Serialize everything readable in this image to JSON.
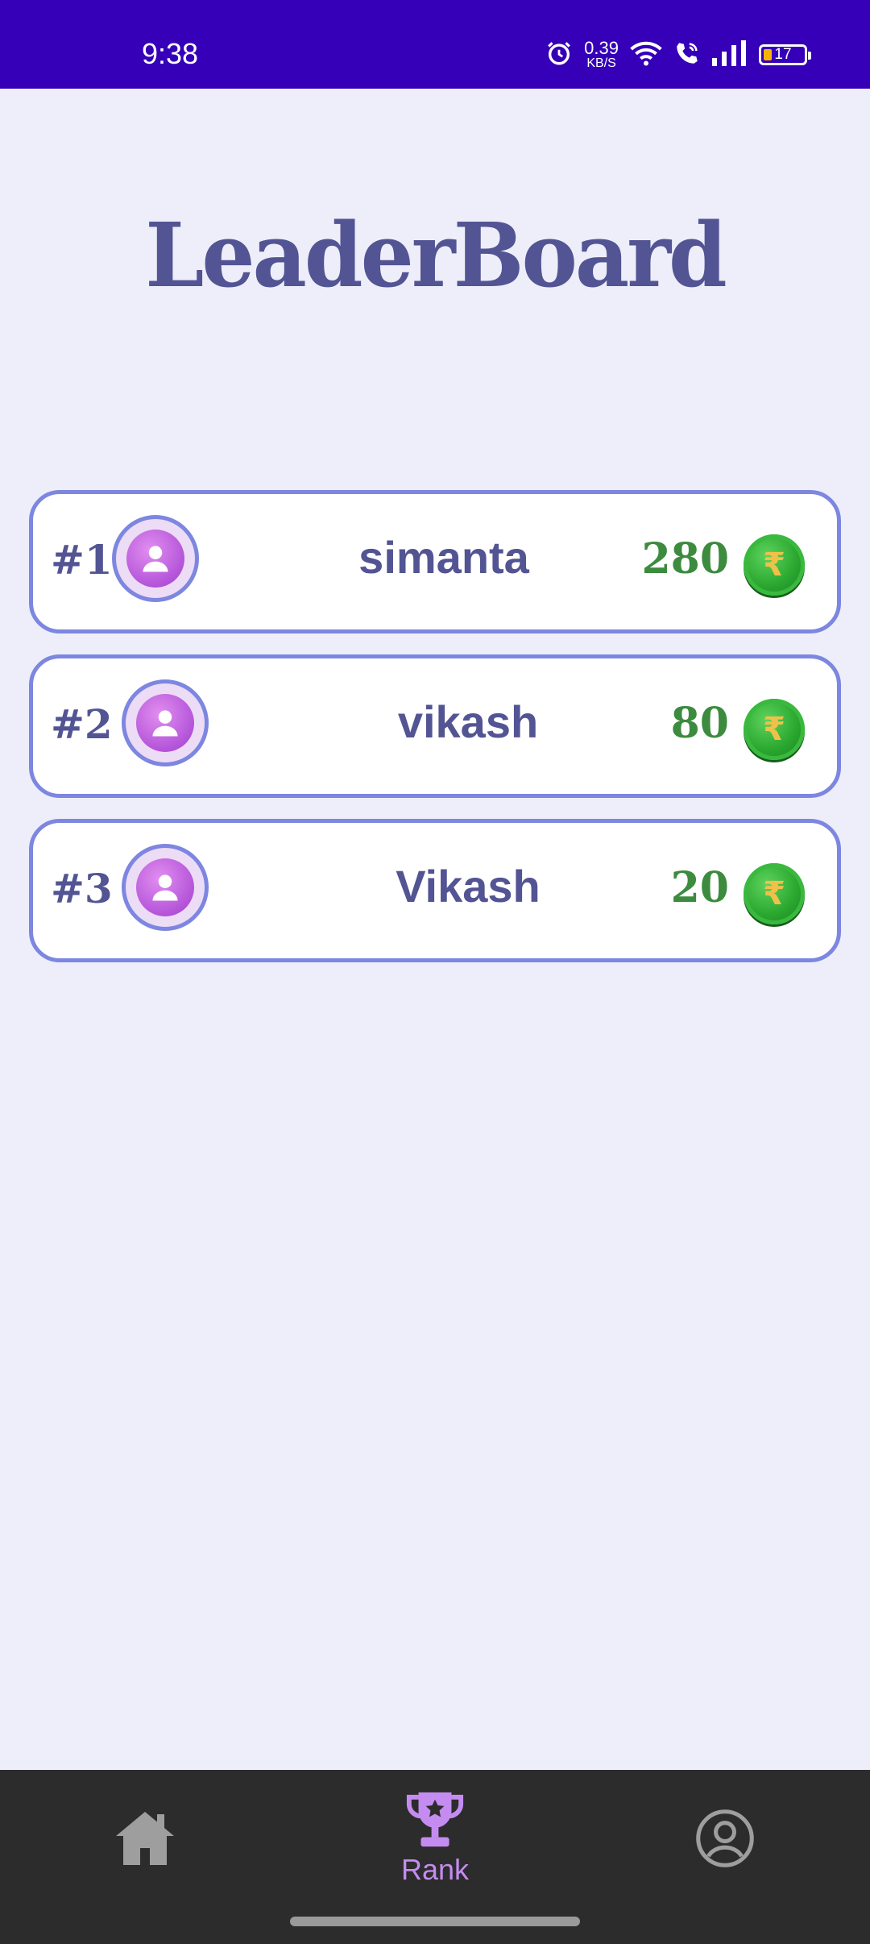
{
  "status_bar": {
    "time": "9:38",
    "net_speed_value": "0.39",
    "net_speed_unit": "KB/S",
    "battery_level": "17",
    "icons": [
      "alarm-icon",
      "wifi-icon",
      "wifi-call-icon",
      "signal-icon",
      "battery-icon"
    ]
  },
  "page": {
    "title": "LeaderBoard"
  },
  "leaderboard": [
    {
      "rank": "#1",
      "name": "simanta",
      "score": "280",
      "coin_symbol": "₹"
    },
    {
      "rank": "#2",
      "name": "vikash",
      "score": "80",
      "coin_symbol": "₹"
    },
    {
      "rank": "#3",
      "name": "Vikash",
      "score": "20",
      "coin_symbol": "₹"
    }
  ],
  "bottom_nav": {
    "items": [
      {
        "icon": "home-icon",
        "label": ""
      },
      {
        "icon": "trophy-icon",
        "label": "Rank",
        "selected": true
      },
      {
        "icon": "profile-icon",
        "label": ""
      }
    ]
  },
  "colors": {
    "status_bar": "#3500b8",
    "background": "#eeeefa",
    "title": "#535493",
    "card_border": "#7d86e0",
    "score": "#3c8b3f",
    "nav_bg": "#2c2c2c",
    "nav_selected": "#c48cf0",
    "nav_unselected": "#9e9e9e"
  }
}
